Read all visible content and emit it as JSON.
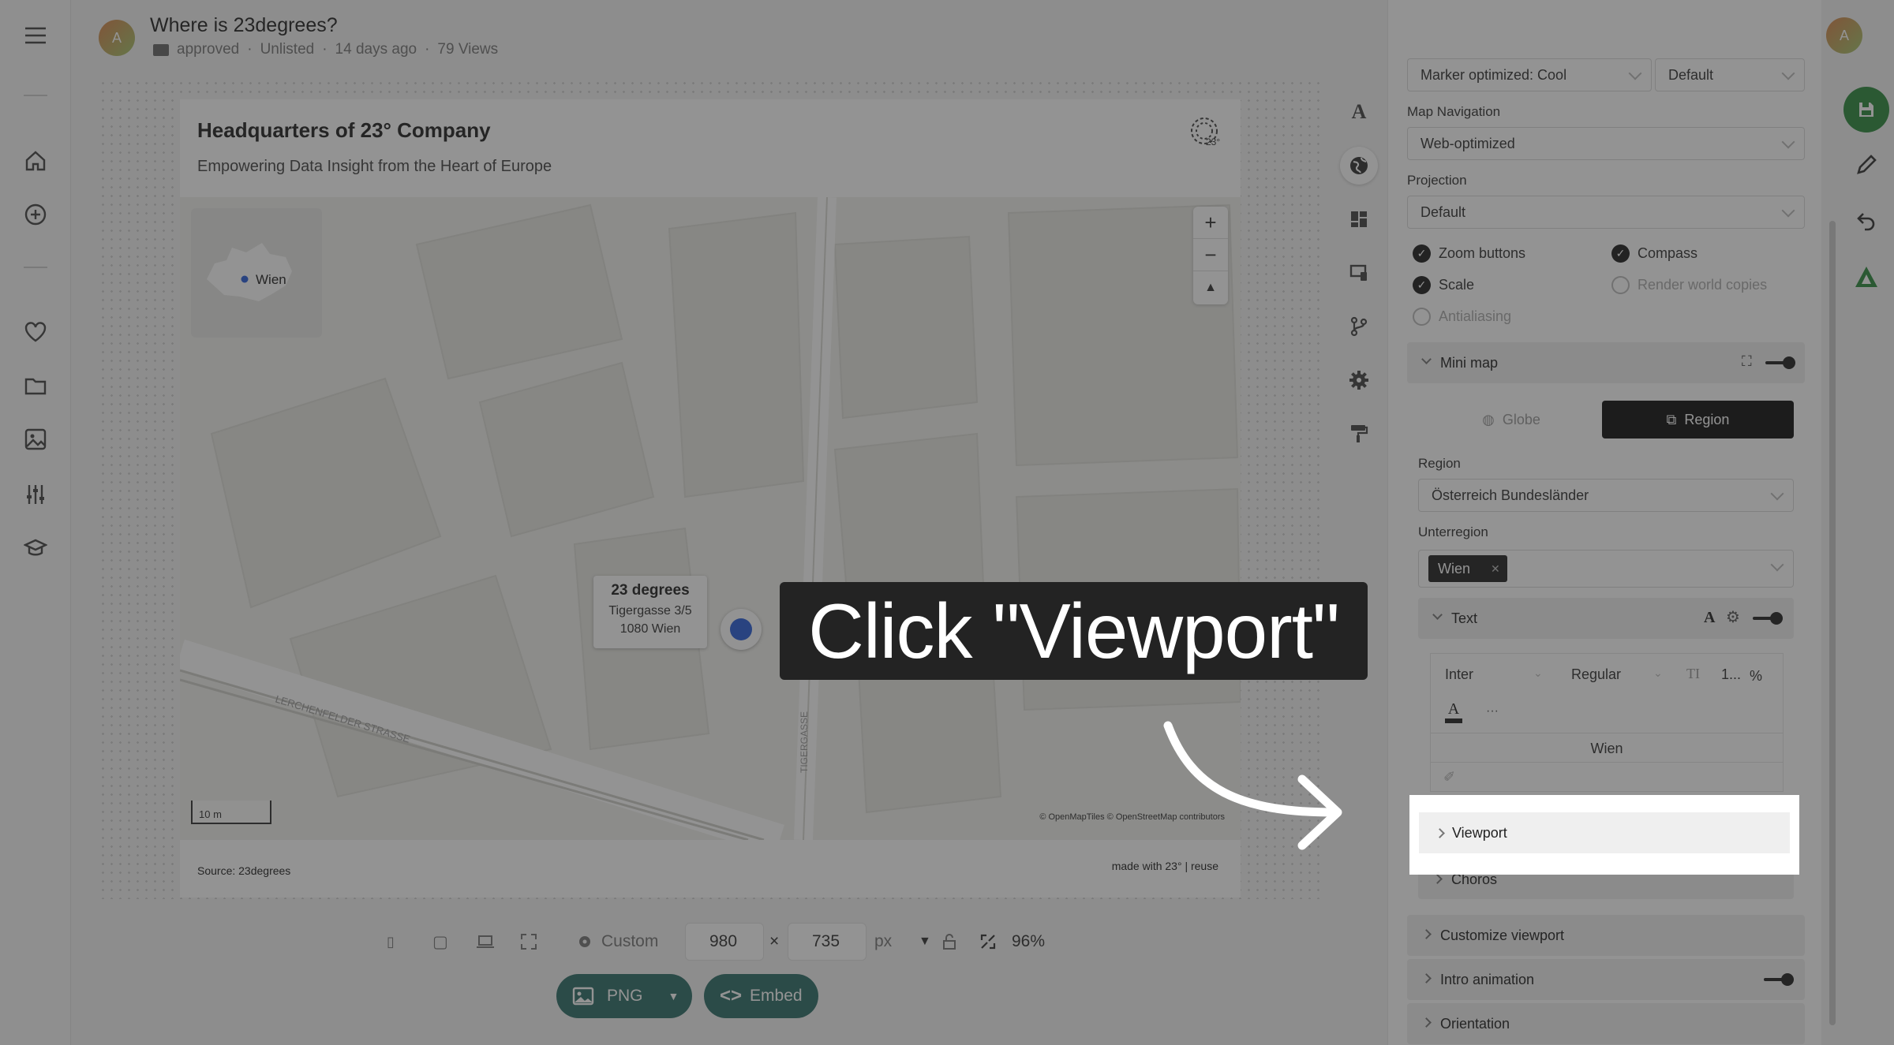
{
  "header": {
    "title": "Where is 23degrees?",
    "folder_label": "approved",
    "visibility": "Unlisted",
    "age": "14 days ago",
    "views": "79 Views",
    "avatar_initial": "A"
  },
  "card": {
    "title": "Headquarters of 23° Company",
    "subtitle": "Empowering Data Insight from the Heart of Europe",
    "source": "Source: 23degrees",
    "made_with": "made with 23° | reuse"
  },
  "map": {
    "minimap_label": "Wien",
    "popup": {
      "name": "23 degrees",
      "street": "Tigergasse 3/5",
      "city": "1080 Wien"
    },
    "scale": "10 m",
    "attribution": "© OpenMapTiles © OpenStreetMap contributors",
    "street_label_1": "LERCHENFELDER STRASSE",
    "street_label_2": "TIGERGASSE",
    "zoom_in": "+",
    "zoom_out": "−",
    "compass": "▲"
  },
  "bottom": {
    "preset": "Custom",
    "width": "980",
    "times": "×",
    "height": "735",
    "unit": "px",
    "zoom": "96%",
    "png_label": "PNG",
    "embed_label": "Embed"
  },
  "panel": {
    "top_select_left": "Marker optimized: Cool",
    "top_select_right": "Default",
    "map_navigation_label": "Map Navigation",
    "map_navigation_value": "Web-optimized",
    "projection_label": "Projection",
    "projection_value": "Default",
    "checks": {
      "zoom_buttons": "Zoom buttons",
      "compass": "Compass",
      "scale": "Scale",
      "render_world_copies": "Render world copies",
      "antialiasing": "Antialiasing"
    },
    "minimap_section": "Mini map",
    "globe_tab": "Globe",
    "region_tab": "Region",
    "region_label": "Region",
    "region_value": "Österreich Bundesländer",
    "subregion_label": "Unterregion",
    "subregion_chip": "Wien",
    "text_section": "Text",
    "font_family": "Inter",
    "font_weight": "Regular",
    "font_size": "1...",
    "font_unit": "%",
    "more": "···",
    "text_value": "Wien",
    "viewport_section": "Viewport",
    "choros_section": "Choros",
    "customize_viewport": "Customize viewport",
    "intro_animation": "Intro animation",
    "orientation": "Orientation"
  },
  "overlay": {
    "callout_text": "Click \"Viewport\""
  },
  "colors": {
    "accent_teal": "#2f6e68",
    "marker_blue": "#2b5fd9",
    "save_green": "#2e8b3e"
  }
}
